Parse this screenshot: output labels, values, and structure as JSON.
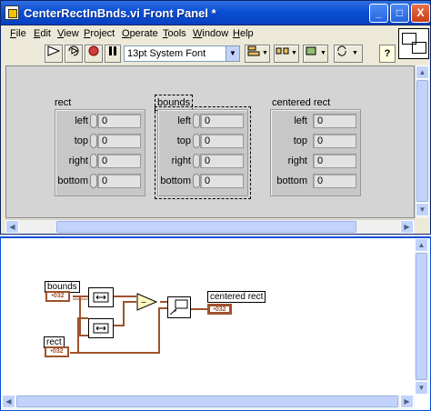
{
  "window": {
    "title": "CenterRectInBnds.vi Front Panel *",
    "controls": {
      "minimize": "_",
      "maximize": "□",
      "close": "X"
    }
  },
  "menu": [
    {
      "label": "File",
      "key": "F",
      "rest": "ile"
    },
    {
      "label": "Edit",
      "key": "E",
      "rest": "dit"
    },
    {
      "label": "View",
      "key": "V",
      "rest": "iew"
    },
    {
      "label": "Project",
      "key": "P",
      "rest": "roject"
    },
    {
      "label": "Operate",
      "key": "O",
      "rest": "perate"
    },
    {
      "label": "Tools",
      "key": "T",
      "rest": "ools"
    },
    {
      "label": "Window",
      "key": "W",
      "rest": "indow"
    },
    {
      "label": "Help",
      "key": "H",
      "rest": "elp"
    }
  ],
  "toolbar": {
    "font": "13pt System Font",
    "icons": [
      "run-arrow-icon",
      "run-continuously-icon",
      "abort-icon",
      "pause-icon",
      "align-icon",
      "distribute-icon",
      "resize-icon",
      "reorder-icon",
      "help-icon"
    ],
    "help_label": "?"
  },
  "clusters": {
    "rect": {
      "label": "rect",
      "fields": [
        {
          "name": "left",
          "value": "0"
        },
        {
          "name": "top",
          "value": "0"
        },
        {
          "name": "right",
          "value": "0"
        },
        {
          "name": "bottom",
          "value": "0"
        }
      ]
    },
    "bounds": {
      "label": "bounds",
      "fields": [
        {
          "name": "left",
          "value": "0"
        },
        {
          "name": "top",
          "value": "0"
        },
        {
          "name": "right",
          "value": "0"
        },
        {
          "name": "bottom",
          "value": "0"
        }
      ]
    },
    "centered": {
      "label": "centered rect",
      "fields": [
        {
          "name": "left",
          "value": "0"
        },
        {
          "name": "top",
          "value": "0"
        },
        {
          "name": "right",
          "value": "0"
        },
        {
          "name": "bottom",
          "value": "0"
        }
      ]
    }
  },
  "diagram": {
    "bounds_label": "bounds",
    "rect_label": "rect",
    "centered_label": "centered rect",
    "terminal_text": "•032"
  },
  "colors": {
    "titlebar": "#0a4fd6",
    "wire": "#a0522d",
    "panel": "#d4d4d4"
  }
}
